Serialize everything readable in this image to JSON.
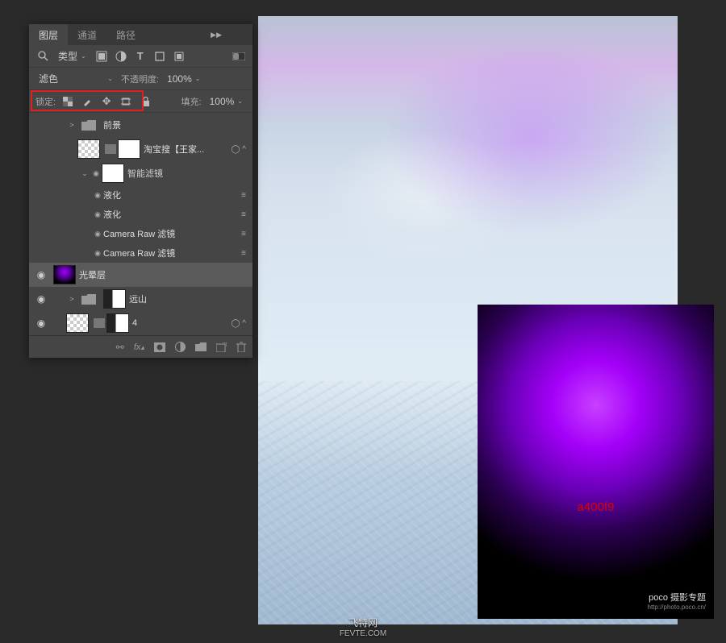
{
  "tabs": {
    "layers": "图层",
    "channels": "通道",
    "paths": "路径"
  },
  "filter_row": {
    "kind": "类型"
  },
  "blend_row": {
    "mode": "滤色",
    "opacity_label": "不透明度:",
    "opacity_value": "100%"
  },
  "lock_row": {
    "lock_label": "锁定:",
    "fill_label": "填充:",
    "fill_value": "100%"
  },
  "layers_list": [
    {
      "vis": "",
      "depth": 1,
      "expand": ">",
      "thumb": "folder",
      "name": "前景"
    },
    {
      "vis": "",
      "depth": 1,
      "expand": "",
      "thumb": "check",
      "mask": true,
      "link": true,
      "name": "淘宝搜【王家...",
      "ctl": "◯ ^"
    },
    {
      "vis": "",
      "depth": 2,
      "expand": "⌄",
      "eye": "◉",
      "thumb": "mask",
      "name": "智能滤镜",
      "sub": true
    },
    {
      "vis": "",
      "depth": 3,
      "eye": "◉",
      "name": "液化",
      "ctl": "≡",
      "filt": true
    },
    {
      "vis": "",
      "depth": 3,
      "eye": "◉",
      "name": "液化",
      "ctl": "≡",
      "filt": true
    },
    {
      "vis": "",
      "depth": 3,
      "eye": "◉",
      "name": "Camera Raw 滤镜",
      "ctl": "≡",
      "filt": true
    },
    {
      "vis": "",
      "depth": 3,
      "eye": "◉",
      "name": "Camera Raw 滤镜",
      "ctl": "≡",
      "filt": true
    },
    {
      "vis": "◉",
      "depth": 0,
      "thumb": "glow",
      "name": "光晕层",
      "sel": true
    },
    {
      "vis": "◉",
      "depth": 1,
      "expand": ">",
      "thumb": "folder",
      "mask": true,
      "maskthumb": "mix",
      "name": "远山"
    },
    {
      "vis": "◉",
      "depth": 1,
      "thumb": "check",
      "mask": true,
      "link": true,
      "maskthumb": "mix",
      "name": "4",
      "ctl": "◯ ^"
    }
  ],
  "purple": {
    "code": "a400f9",
    "brand": "poco 摄影专题",
    "url": "http://photo.poco.cn/"
  },
  "watermark": {
    "name": "飞特网",
    "url": "FEVTE.COM"
  }
}
